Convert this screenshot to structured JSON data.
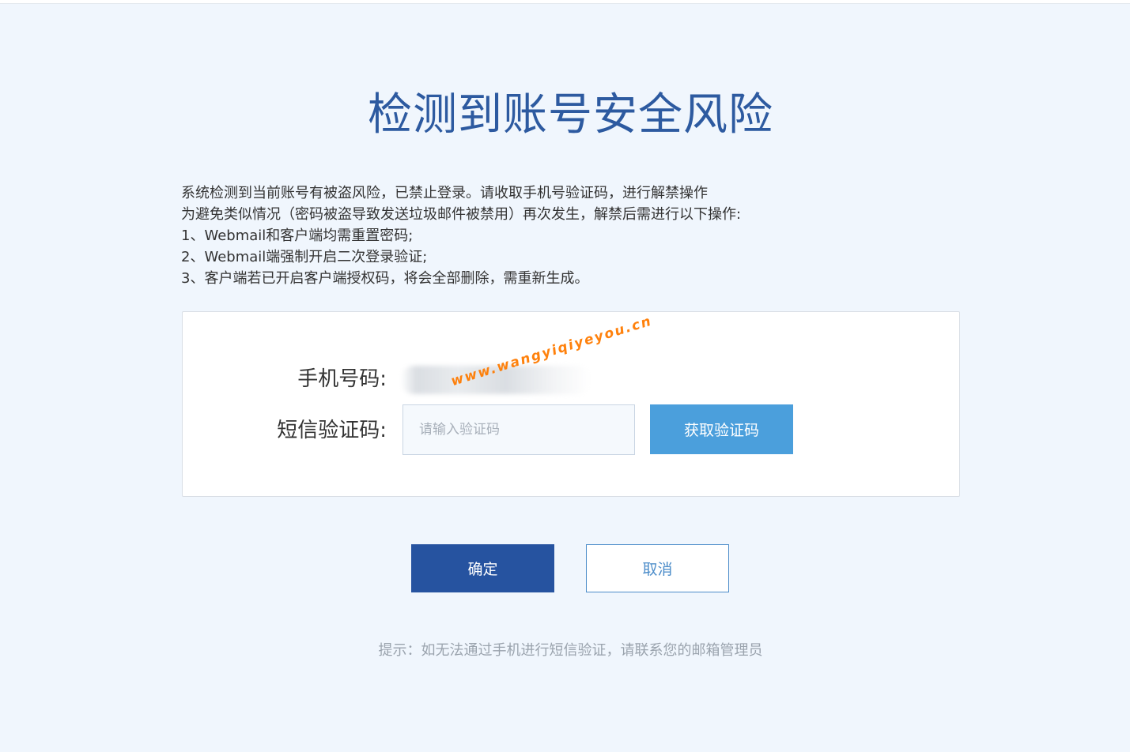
{
  "page": {
    "title": "检测到账号安全风险"
  },
  "notice": {
    "lines": [
      "系统检测到当前账号有被盗风险，已禁止登录。请收取手机号验证码，进行解禁操作",
      "为避免类似情况（密码被盗导致发送垃圾邮件被禁用）再次发生，解禁后需进行以下操作:",
      "1、Webmail和客户端均需重置密码;",
      "2、Webmail端强制开启二次登录验证;",
      "3、客户端若已开启客户端授权码，将会全部删除，需重新生成。"
    ]
  },
  "form": {
    "phone_label": "手机号码:",
    "code_label": "短信验证码:",
    "code_placeholder": "请输入验证码",
    "get_code_label": "获取验证码"
  },
  "watermark": {
    "text": "www.wangyiqiyeyou.cn"
  },
  "actions": {
    "ok_label": "确定",
    "cancel_label": "取消"
  },
  "hint": {
    "text": "提示：如无法通过手机进行短信验证，请联系您的邮箱管理员"
  },
  "colors": {
    "background": "#f0f6fd",
    "title": "#2d5aa0",
    "primary_button": "#2653a0",
    "get_code_button": "#4b9fdc",
    "cancel_border": "#4b8cc9",
    "watermark": "#ff7b00"
  }
}
